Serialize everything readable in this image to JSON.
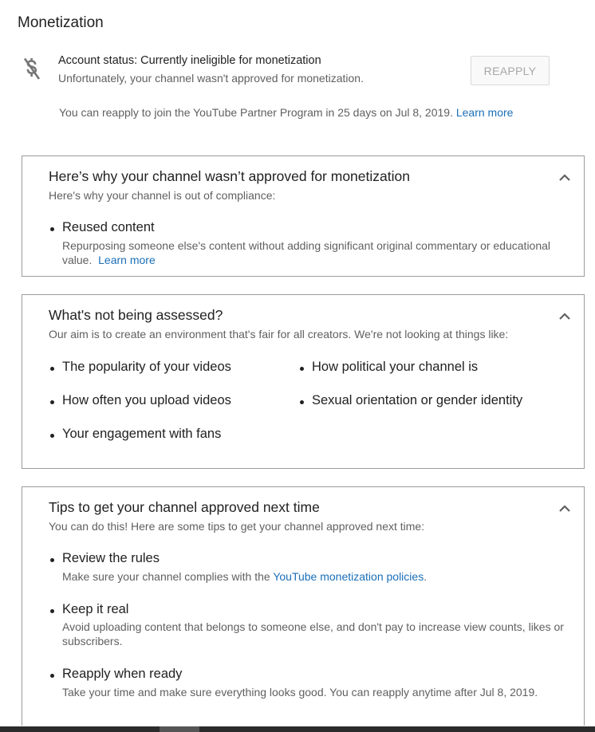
{
  "page": {
    "title": "Monetization"
  },
  "status": {
    "icon": "no-monetization-icon",
    "headline": "Account status: Currently ineligible for monetization",
    "detail": "Unfortunately, your channel wasn't approved for monetization.",
    "reapply_button": "REAPPLY",
    "reapply_note": "You can reapply to join the YouTube Partner Program in 25 days on Jul 8, 2019.",
    "learn_more": "Learn more"
  },
  "why_card": {
    "title": "Here’s why your channel wasn’t approved for monetization",
    "subtitle": "Here's why your channel is out of compliance:",
    "reason_title": "Reused content",
    "reason_desc_line1": "Repurposing someone else's content without adding significant original commentary or educational",
    "reason_desc_line2": "value.",
    "learn_more": "Learn more"
  },
  "assessed_card": {
    "title": "What's not being assessed?",
    "subtitle": "Our aim is to create an environment that's fair for all creators. We're not looking at things like:",
    "items": [
      "The popularity of your videos",
      "How often you upload videos",
      "Your engagement with fans",
      "How political your channel is",
      "Sexual orientation or gender identity"
    ]
  },
  "tips_card": {
    "title": "Tips to get your channel approved next time",
    "subtitle": "You can do this! Here are some tips to get your channel approved next time:",
    "tips": [
      {
        "title": "Review the rules",
        "desc_prefix": "Make sure your channel complies with the ",
        "desc_link": "YouTube monetization policies",
        "desc_suffix": "."
      },
      {
        "title": "Keep it real",
        "desc_line1": "Avoid uploading content that belongs to someone else, and don't pay to increase view counts, likes or",
        "desc_line2": "subscribers."
      },
      {
        "title": "Reapply when ready",
        "desc": "Take your time and make sure everything looks good. You can reapply anytime after Jul 8, 2019."
      }
    ]
  },
  "colors": {
    "link": "#1a6fb8",
    "muted_text": "#606060",
    "primary_text": "#212121",
    "card_border": "#9b9b9b"
  }
}
